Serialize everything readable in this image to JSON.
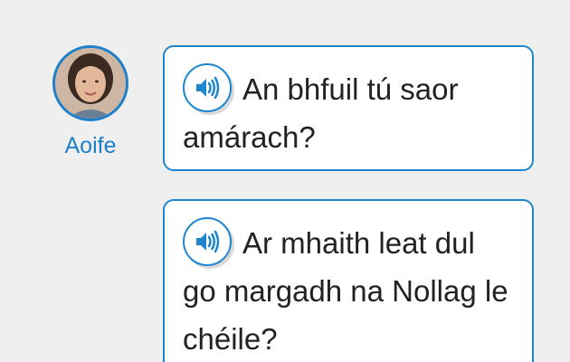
{
  "speaker": {
    "name": "Aoife"
  },
  "messages": [
    {
      "text": "An bhfuil tú saor amárach?",
      "audio_icon": "speaker-icon"
    },
    {
      "text": "Ar mhaith leat dul go margadh na Nollag le chéile?",
      "audio_icon": "speaker-icon"
    }
  ],
  "colors": {
    "accent": "#1e86cf",
    "background": "#efefef",
    "bubble": "#ffffff",
    "text": "#222222"
  }
}
